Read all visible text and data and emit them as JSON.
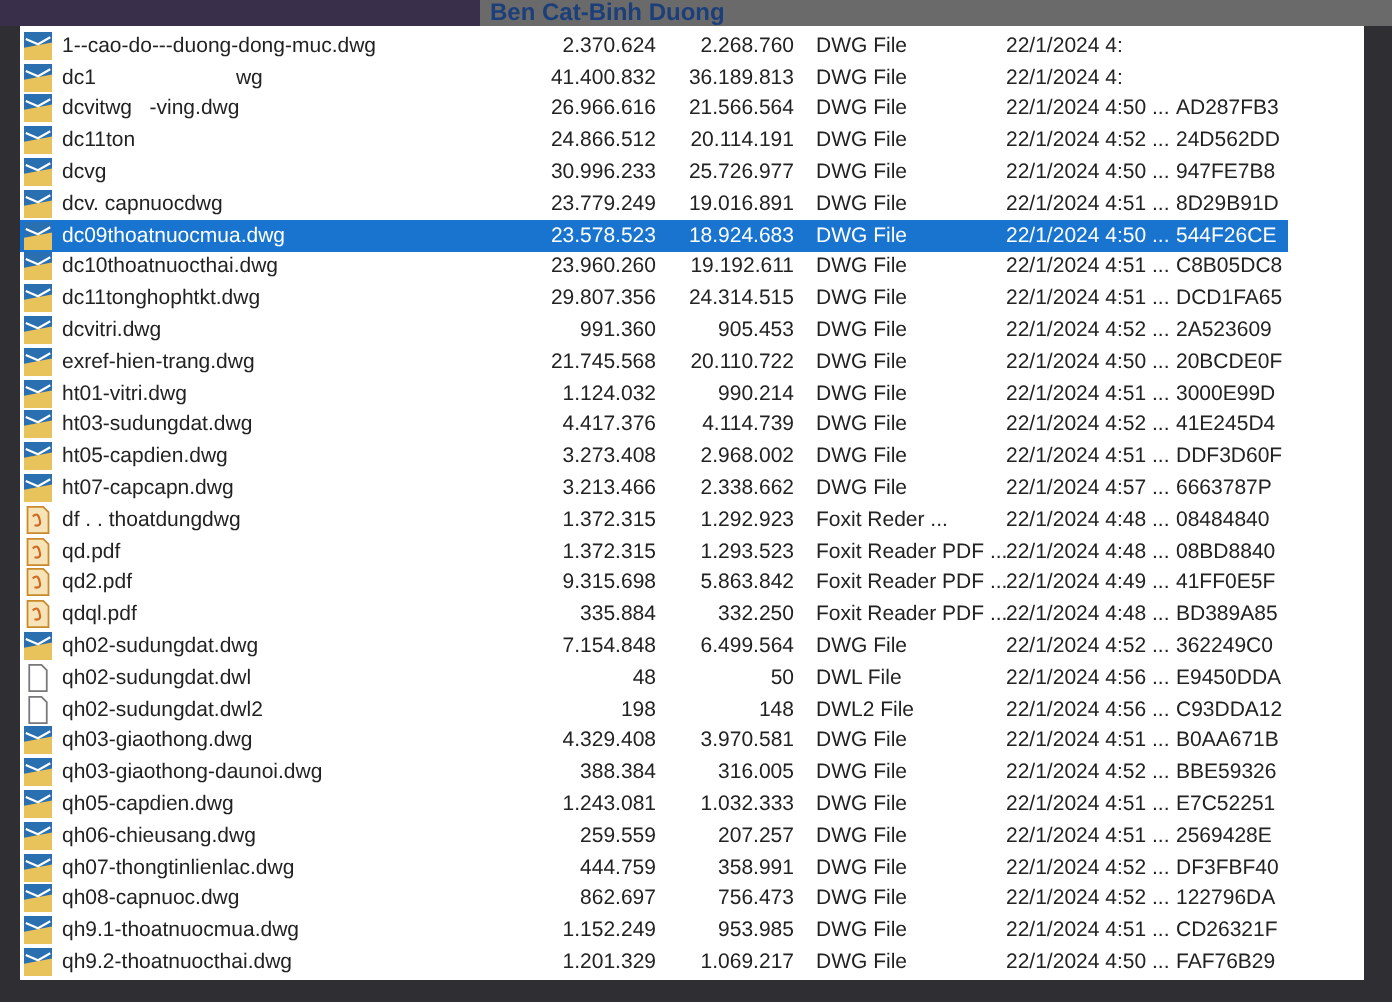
{
  "banner": {
    "title": "Ben Cat-Binh Duong"
  },
  "files": [
    {
      "name": "1--cao-do---duong-dong-muc.dwg",
      "size": "2.370.624",
      "packed": "2.268.760",
      "type": "DWG File",
      "modified": "22/1/2024 4:",
      "kind": "dwg",
      "selected": false
    },
    {
      "name": "dc1                        wg",
      "size": "41.400.832",
      "packed": "36.189.813",
      "type": "DWG File",
      "modified": "22/1/2024 4:",
      "kind": "dwg",
      "selected": false
    },
    {
      "name": "dcvitwg   -ving.dwg",
      "size": "26.966.616",
      "packed": "21.566.564",
      "type": "DWG File",
      "modified": "22/1/2024 4:50 ...",
      "crc": "AD287FB3",
      "kind": "dwg",
      "selected": false
    },
    {
      "name": "dc11ton",
      "size": "24.866.512",
      "packed": "20.114.191",
      "type": "DWG File",
      "modified": "22/1/2024 4:52 ...",
      "crc": "24D562DD",
      "kind": "dwg",
      "selected": false
    },
    {
      "name": "dcvg",
      "size": "30.996.233",
      "packed": "25.726.977",
      "type": "DWG File",
      "modified": "22/1/2024 4:50 ...",
      "crc": "947FE7B8",
      "kind": "dwg",
      "selected": false
    },
    {
      "name": "dcv. capnuocdwg",
      "size": "23.779.249",
      "packed": "19.016.891",
      "type": "DWG File",
      "modified": "22/1/2024 4:51 ...",
      "crc": "8D29B91D",
      "kind": "dwg",
      "selected": false
    },
    {
      "name": "dc09thoatnuocmua.dwg",
      "size": "23.578.523",
      "packed": "18.924.683",
      "type": "DWG File",
      "modified": "22/1/2024 4:50 ...",
      "crc": "544F26CE",
      "kind": "dwg",
      "selected": true
    },
    {
      "name": "dc10thoatnuocthai.dwg",
      "size": "23.960.260",
      "packed": "19.192.611",
      "type": "DWG File",
      "modified": "22/1/2024 4:51 ...",
      "crc": "C8B05DC8",
      "kind": "dwg",
      "selected": false
    },
    {
      "name": "dc11tonghophtkt.dwg",
      "size": "29.807.356",
      "packed": "24.314.515",
      "type": "DWG File",
      "modified": "22/1/2024 4:51 ...",
      "crc": "DCD1FA65",
      "kind": "dwg",
      "selected": false
    },
    {
      "name": "dcvitri.dwg",
      "size": "991.360",
      "packed": "905.453",
      "type": "DWG File",
      "modified": "22/1/2024 4:52 ...",
      "crc": "2A523609",
      "kind": "dwg",
      "selected": false
    },
    {
      "name": "exref-hien-trang.dwg",
      "size": "21.745.568",
      "packed": "20.110.722",
      "type": "DWG File",
      "modified": "22/1/2024 4:50 ...",
      "crc": "20BCDE0F",
      "kind": "dwg",
      "selected": false
    },
    {
      "name": "ht01-vitri.dwg",
      "size": "1.124.032",
      "packed": "990.214",
      "type": "DWG File",
      "modified": "22/1/2024 4:51 ...",
      "crc": "3000E99D",
      "kind": "dwg",
      "selected": false
    },
    {
      "name": "ht03-sudungdat.dwg",
      "size": "4.417.376",
      "packed": "4.114.739",
      "type": "DWG File",
      "modified": "22/1/2024 4:52 ...",
      "crc": "41E245D4",
      "kind": "dwg",
      "selected": false
    },
    {
      "name": "ht05-capdien.dwg",
      "size": "3.273.408",
      "packed": "2.968.002",
      "type": "DWG File",
      "modified": "22/1/2024 4:51 ...",
      "crc": "DDF3D60F",
      "kind": "dwg",
      "selected": false
    },
    {
      "name": "ht07-capcapn.dwg",
      "size": "3.213.466",
      "packed": "2.338.662",
      "type": "DWG File",
      "modified": "22/1/2024 4:57 ...",
      "crc": "6663787P",
      "kind": "dwg",
      "selected": false
    },
    {
      "name": "df . . thoatdungdwg",
      "size": "1.372.315",
      "packed": "1.292.923",
      "type": "Foxit Reder ...",
      "modified": "22/1/2024 4:48 ...",
      "crc": "08484840",
      "kind": "pdf",
      "selected": false
    },
    {
      "name": "qd.pdf",
      "size": "1.372.315",
      "packed": "1.293.523",
      "type": "Foxit Reader PDF ...",
      "modified": "22/1/2024 4:48 ...",
      "crc": "08BD8840",
      "kind": "pdf",
      "selected": false
    },
    {
      "name": "qd2.pdf",
      "size": "9.315.698",
      "packed": "5.863.842",
      "type": "Foxit Reader PDF ...",
      "modified": "22/1/2024 4:49 ...",
      "crc": "41FF0E5F",
      "kind": "pdf",
      "selected": false
    },
    {
      "name": "qdql.pdf",
      "size": "335.884",
      "packed": "332.250",
      "type": "Foxit Reader PDF ...",
      "modified": "22/1/2024 4:48 ...",
      "crc": "BD389A85",
      "kind": "pdf",
      "selected": false
    },
    {
      "name": "qh02-sudungdat.dwg",
      "size": "7.154.848",
      "packed": "6.499.564",
      "type": "DWG File",
      "modified": "22/1/2024 4:52 ...",
      "crc": "362249C0",
      "kind": "dwg",
      "selected": false
    },
    {
      "name": "qh02-sudungdat.dwl",
      "size": "48",
      "packed": "50",
      "type": "DWL File",
      "modified": "22/1/2024 4:56 ...",
      "crc": "E9450DDA",
      "kind": "file",
      "selected": false
    },
    {
      "name": "qh02-sudungdat.dwl2",
      "size": "198",
      "packed": "148",
      "type": "DWL2 File",
      "modified": "22/1/2024 4:56 ...",
      "crc": "C93DDA12",
      "kind": "file",
      "selected": false
    },
    {
      "name": "qh03-giaothong.dwg",
      "size": "4.329.408",
      "packed": "3.970.581",
      "type": "DWG File",
      "modified": "22/1/2024 4:51 ...",
      "crc": "B0AA671B",
      "kind": "dwg",
      "selected": false
    },
    {
      "name": "qh03-giaothong-daunoi.dwg",
      "size": "388.384",
      "packed": "316.005",
      "type": "DWG File",
      "modified": "22/1/2024 4:52 ...",
      "crc": "BBE59326",
      "kind": "dwg",
      "selected": false
    },
    {
      "name": "qh05-capdien.dwg",
      "size": "1.243.081",
      "packed": "1.032.333",
      "type": "DWG File",
      "modified": "22/1/2024 4:51 ...",
      "crc": "E7C52251",
      "kind": "dwg",
      "selected": false
    },
    {
      "name": "qh06-chieusang.dwg",
      "size": "259.559",
      "packed": "207.257",
      "type": "DWG File",
      "modified": "22/1/2024 4:51 ...",
      "crc": "2569428E",
      "kind": "dwg",
      "selected": false
    },
    {
      "name": "qh07-thongtinlienlac.dwg",
      "size": "444.759",
      "packed": "358.991",
      "type": "DWG File",
      "modified": "22/1/2024 4:52 ...",
      "crc": "DF3FBF40",
      "kind": "dwg",
      "selected": false
    },
    {
      "name": "qh08-capnuoc.dwg",
      "size": "862.697",
      "packed": "756.473",
      "type": "DWG File",
      "modified": "22/1/2024 4:52 ...",
      "crc": "122796DA",
      "kind": "dwg",
      "selected": false
    },
    {
      "name": "qh9.1-thoatnuocmua.dwg",
      "size": "1.152.249",
      "packed": "953.985",
      "type": "DWG File",
      "modified": "22/1/2024 4:51 ...",
      "crc": "CD26321F",
      "kind": "dwg",
      "selected": false
    },
    {
      "name": "qh9.2-thoatnuocthai.dwg",
      "size": "1.201.329",
      "packed": "1.069.217",
      "type": "DWG File",
      "modified": "22/1/2024 4:50 ...",
      "crc": "FAF76B29",
      "kind": "dwg",
      "selected": false
    }
  ]
}
